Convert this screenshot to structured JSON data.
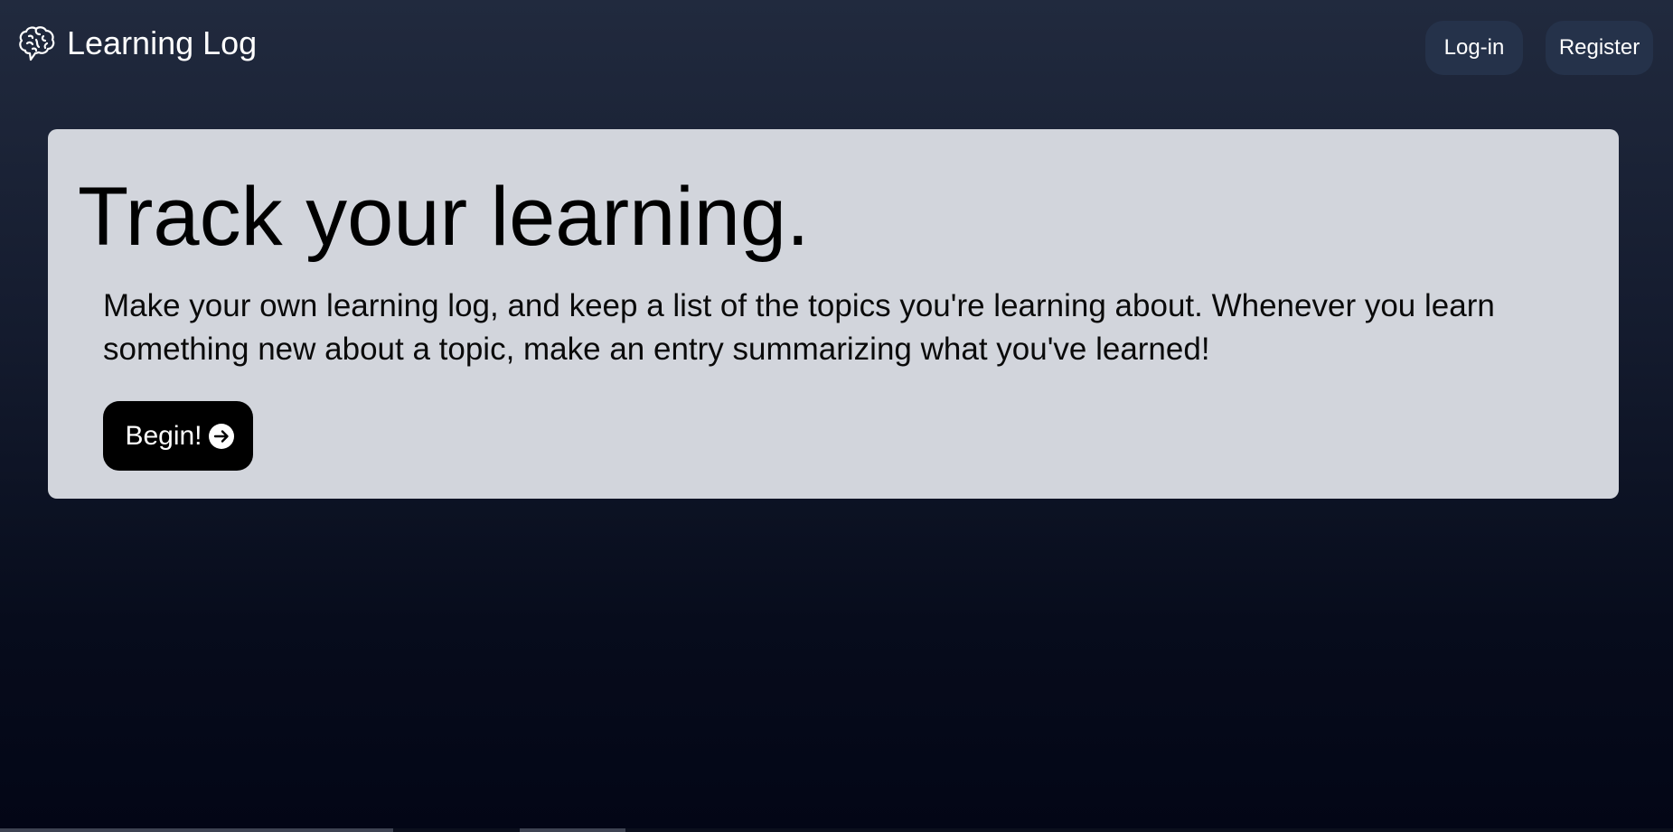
{
  "navbar": {
    "brand": {
      "icon": "brain-icon",
      "title": "Learning Log"
    },
    "links": {
      "login": "Log-in",
      "register": "Register"
    }
  },
  "hero": {
    "title": "Track your learning.",
    "description": "Make your own learning log, and keep a list of the topics you're learning about. Whenever you learn something new about a topic, make an entry summarizing what you've learned!",
    "cta": {
      "label": "Begin!",
      "icon": "arrow-right-circle-icon"
    }
  },
  "colors": {
    "background_top": "#212a3e",
    "background_bottom": "#030616",
    "nav_button": "#25324a",
    "hero_panel": "#d2d5dc",
    "cta_button": "#000000"
  }
}
